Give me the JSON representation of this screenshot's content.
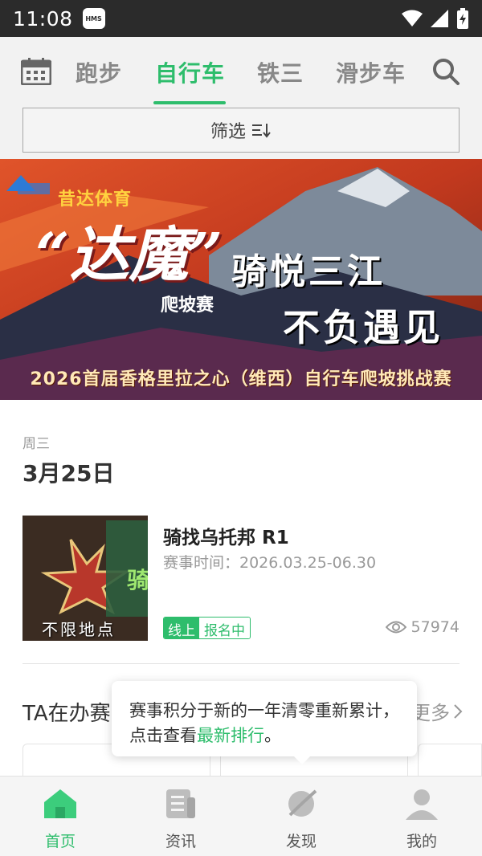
{
  "status_bar": {
    "time": "11:08",
    "badge": "HMS"
  },
  "top_tabs": {
    "items": [
      {
        "label": "跑步"
      },
      {
        "label": "自行车",
        "active": true
      },
      {
        "label": "铁三"
      },
      {
        "label": "滑步车"
      }
    ]
  },
  "filter": {
    "label": "筛选"
  },
  "banner": {
    "brand": "昔达体育",
    "calligraphy": "“达魔”",
    "calligraphy_sub": "爬坡赛",
    "title_line1": "骑悦三江",
    "title_line2": "不负遇见",
    "subtitle": "2026首届香格里拉之心（维西）自行车爬坡挑战赛"
  },
  "date_section": {
    "weekday": "周三",
    "date": "3月25日"
  },
  "event": {
    "thumb_location": "不限地点",
    "title": "骑找乌托邦 R1",
    "time": "赛事时间：2026.03.25-06.30",
    "tag_online": "线上",
    "tag_status": "报名中",
    "views": "57974"
  },
  "section": {
    "title": "TA在办赛",
    "more": "更多"
  },
  "tooltip": {
    "text": "赛事积分于新的一年清零重新累计，点击查看",
    "link": "最新排行",
    "end": "。"
  },
  "bottom_nav": {
    "items": [
      {
        "label": "首页",
        "active": true,
        "icon": "home-icon"
      },
      {
        "label": "资讯",
        "icon": "news-icon"
      },
      {
        "label": "发现",
        "icon": "discover-icon"
      },
      {
        "label": "我的",
        "icon": "profile-icon"
      }
    ]
  },
  "colors": {
    "accent": "#2ebd6c",
    "status_bar": "#2b2b2b"
  }
}
